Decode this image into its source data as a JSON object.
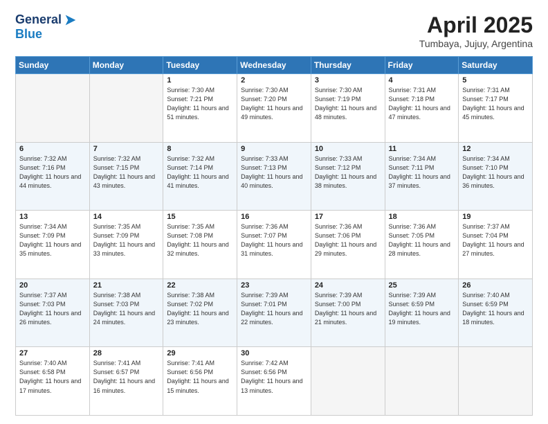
{
  "header": {
    "logo_line1": "General",
    "logo_line2": "Blue",
    "month": "April 2025",
    "location": "Tumbaya, Jujuy, Argentina"
  },
  "days_of_week": [
    "Sunday",
    "Monday",
    "Tuesday",
    "Wednesday",
    "Thursday",
    "Friday",
    "Saturday"
  ],
  "weeks": [
    [
      {
        "day": "",
        "info": ""
      },
      {
        "day": "",
        "info": ""
      },
      {
        "day": "1",
        "info": "Sunrise: 7:30 AM\nSunset: 7:21 PM\nDaylight: 11 hours and 51 minutes."
      },
      {
        "day": "2",
        "info": "Sunrise: 7:30 AM\nSunset: 7:20 PM\nDaylight: 11 hours and 49 minutes."
      },
      {
        "day": "3",
        "info": "Sunrise: 7:30 AM\nSunset: 7:19 PM\nDaylight: 11 hours and 48 minutes."
      },
      {
        "day": "4",
        "info": "Sunrise: 7:31 AM\nSunset: 7:18 PM\nDaylight: 11 hours and 47 minutes."
      },
      {
        "day": "5",
        "info": "Sunrise: 7:31 AM\nSunset: 7:17 PM\nDaylight: 11 hours and 45 minutes."
      }
    ],
    [
      {
        "day": "6",
        "info": "Sunrise: 7:32 AM\nSunset: 7:16 PM\nDaylight: 11 hours and 44 minutes."
      },
      {
        "day": "7",
        "info": "Sunrise: 7:32 AM\nSunset: 7:15 PM\nDaylight: 11 hours and 43 minutes."
      },
      {
        "day": "8",
        "info": "Sunrise: 7:32 AM\nSunset: 7:14 PM\nDaylight: 11 hours and 41 minutes."
      },
      {
        "day": "9",
        "info": "Sunrise: 7:33 AM\nSunset: 7:13 PM\nDaylight: 11 hours and 40 minutes."
      },
      {
        "day": "10",
        "info": "Sunrise: 7:33 AM\nSunset: 7:12 PM\nDaylight: 11 hours and 38 minutes."
      },
      {
        "day": "11",
        "info": "Sunrise: 7:34 AM\nSunset: 7:11 PM\nDaylight: 11 hours and 37 minutes."
      },
      {
        "day": "12",
        "info": "Sunrise: 7:34 AM\nSunset: 7:10 PM\nDaylight: 11 hours and 36 minutes."
      }
    ],
    [
      {
        "day": "13",
        "info": "Sunrise: 7:34 AM\nSunset: 7:09 PM\nDaylight: 11 hours and 35 minutes."
      },
      {
        "day": "14",
        "info": "Sunrise: 7:35 AM\nSunset: 7:09 PM\nDaylight: 11 hours and 33 minutes."
      },
      {
        "day": "15",
        "info": "Sunrise: 7:35 AM\nSunset: 7:08 PM\nDaylight: 11 hours and 32 minutes."
      },
      {
        "day": "16",
        "info": "Sunrise: 7:36 AM\nSunset: 7:07 PM\nDaylight: 11 hours and 31 minutes."
      },
      {
        "day": "17",
        "info": "Sunrise: 7:36 AM\nSunset: 7:06 PM\nDaylight: 11 hours and 29 minutes."
      },
      {
        "day": "18",
        "info": "Sunrise: 7:36 AM\nSunset: 7:05 PM\nDaylight: 11 hours and 28 minutes."
      },
      {
        "day": "19",
        "info": "Sunrise: 7:37 AM\nSunset: 7:04 PM\nDaylight: 11 hours and 27 minutes."
      }
    ],
    [
      {
        "day": "20",
        "info": "Sunrise: 7:37 AM\nSunset: 7:03 PM\nDaylight: 11 hours and 26 minutes."
      },
      {
        "day": "21",
        "info": "Sunrise: 7:38 AM\nSunset: 7:03 PM\nDaylight: 11 hours and 24 minutes."
      },
      {
        "day": "22",
        "info": "Sunrise: 7:38 AM\nSunset: 7:02 PM\nDaylight: 11 hours and 23 minutes."
      },
      {
        "day": "23",
        "info": "Sunrise: 7:39 AM\nSunset: 7:01 PM\nDaylight: 11 hours and 22 minutes."
      },
      {
        "day": "24",
        "info": "Sunrise: 7:39 AM\nSunset: 7:00 PM\nDaylight: 11 hours and 21 minutes."
      },
      {
        "day": "25",
        "info": "Sunrise: 7:39 AM\nSunset: 6:59 PM\nDaylight: 11 hours and 19 minutes."
      },
      {
        "day": "26",
        "info": "Sunrise: 7:40 AM\nSunset: 6:59 PM\nDaylight: 11 hours and 18 minutes."
      }
    ],
    [
      {
        "day": "27",
        "info": "Sunrise: 7:40 AM\nSunset: 6:58 PM\nDaylight: 11 hours and 17 minutes."
      },
      {
        "day": "28",
        "info": "Sunrise: 7:41 AM\nSunset: 6:57 PM\nDaylight: 11 hours and 16 minutes."
      },
      {
        "day": "29",
        "info": "Sunrise: 7:41 AM\nSunset: 6:56 PM\nDaylight: 11 hours and 15 minutes."
      },
      {
        "day": "30",
        "info": "Sunrise: 7:42 AM\nSunset: 6:56 PM\nDaylight: 11 hours and 13 minutes."
      },
      {
        "day": "",
        "info": ""
      },
      {
        "day": "",
        "info": ""
      },
      {
        "day": "",
        "info": ""
      }
    ]
  ]
}
